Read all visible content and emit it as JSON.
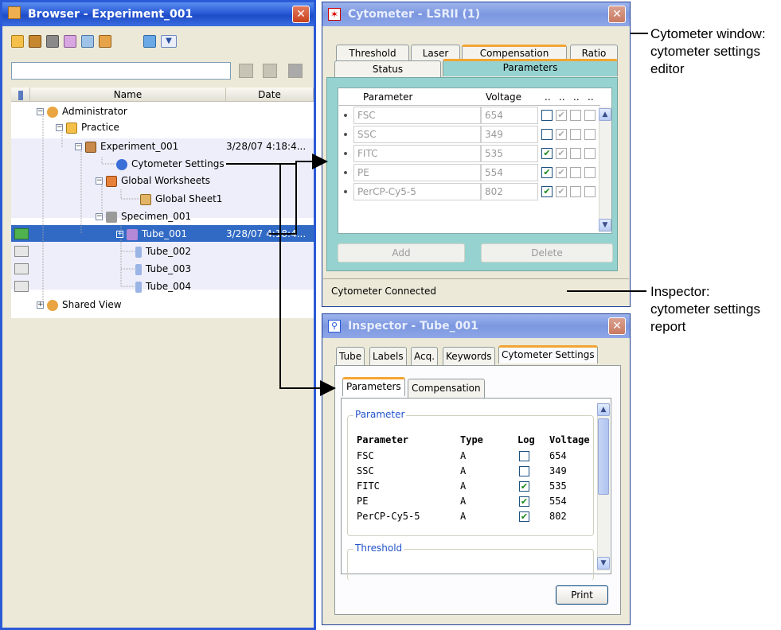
{
  "browser": {
    "title": "Browser - Experiment_001",
    "columns": {
      "name": "Name",
      "date": "Date"
    },
    "tree": [
      {
        "label": "Administrator",
        "date": ""
      },
      {
        "label": "Practice",
        "date": ""
      },
      {
        "label": "Experiment_001",
        "date": "3/28/07 4:18:4..."
      },
      {
        "label": "Cytometer Settings",
        "date": ""
      },
      {
        "label": "Global Worksheets",
        "date": ""
      },
      {
        "label": "Global Sheet1",
        "date": ""
      },
      {
        "label": "Specimen_001",
        "date": ""
      },
      {
        "label": "Tube_001",
        "date": "3/28/07 4:18:4..."
      },
      {
        "label": "Tube_002",
        "date": ""
      },
      {
        "label": "Tube_003",
        "date": ""
      },
      {
        "label": "Tube_004",
        "date": ""
      },
      {
        "label": "Shared View",
        "date": ""
      }
    ]
  },
  "cytometer": {
    "title": "Cytometer - LSRII (1)",
    "tabs_back": [
      "Threshold",
      "Laser",
      "Compensation",
      "Ratio"
    ],
    "tabs_front": [
      "Status",
      "Parameters"
    ],
    "grid_headers": {
      "parameter": "Parameter",
      "voltage": "Voltage",
      "c1": "..",
      "c2": "..",
      "c3": "..",
      "c4": ".."
    },
    "rows": [
      {
        "name": "FSC",
        "voltage": "654",
        "log": false
      },
      {
        "name": "SSC",
        "voltage": "349",
        "log": false
      },
      {
        "name": "FITC",
        "voltage": "535",
        "log": true
      },
      {
        "name": "PE",
        "voltage": "554",
        "log": true
      },
      {
        "name": "PerCP-Cy5-5",
        "voltage": "802",
        "log": true
      }
    ],
    "add_label": "Add",
    "delete_label": "Delete",
    "status": "Cytometer Connected"
  },
  "inspector": {
    "title": "Inspector - Tube_001",
    "tabs": [
      "Tube",
      "Labels",
      "Acq.",
      "Keywords",
      "Cytometer Settings"
    ],
    "subtabs": [
      "Parameters",
      "Compensation"
    ],
    "group_parameter": "Parameter",
    "group_threshold": "Threshold",
    "headers": {
      "parameter": "Parameter",
      "type": "Type",
      "log": "Log",
      "voltage": "Voltage"
    },
    "rows": [
      {
        "name": "FSC",
        "type": "A",
        "log": false,
        "voltage": "654"
      },
      {
        "name": "SSC",
        "type": "A",
        "log": false,
        "voltage": "349"
      },
      {
        "name": "FITC",
        "type": "A",
        "log": true,
        "voltage": "535"
      },
      {
        "name": "PE",
        "type": "A",
        "log": true,
        "voltage": "554"
      },
      {
        "name": "PerCP-Cy5-5",
        "type": "A",
        "log": true,
        "voltage": "802"
      }
    ],
    "print_label": "Print"
  },
  "callouts": {
    "cytometer_line1": "Cytometer window:",
    "cytometer_line2": "cytometer settings",
    "cytometer_line3": "editor",
    "inspector_line1": "Inspector:",
    "inspector_line2": "cytometer settings",
    "inspector_line3": "report"
  },
  "check_mark": "✔"
}
